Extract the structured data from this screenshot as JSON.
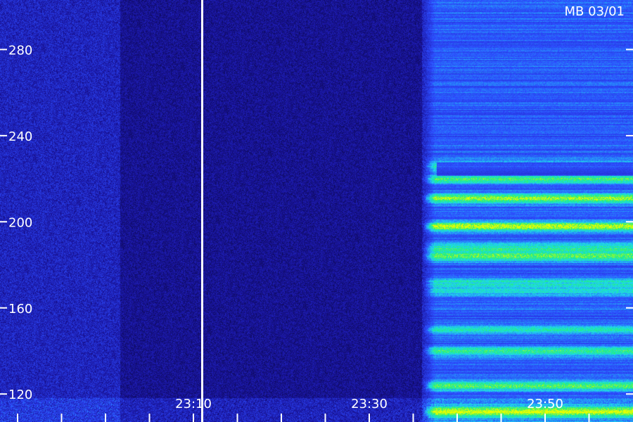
{
  "station_label": "MB 03/01",
  "chart_data": {
    "type": "heatmap",
    "title": "",
    "xlabel": "",
    "ylabel": "",
    "x_tick_labels": [
      "23:10",
      "23:30",
      "23:50"
    ],
    "x_minor_ticks_minutes": [
      -10,
      -5,
      0,
      5,
      10,
      15,
      20,
      25,
      30,
      35,
      40,
      45,
      50,
      55
    ],
    "y_tick_labels": [
      "280",
      "240",
      "200",
      "160",
      "120"
    ],
    "y_ticks": [
      280,
      240,
      200,
      160,
      120
    ],
    "ylim": [
      107,
      303
    ],
    "xlim_minutes_after_2300": [
      -12,
      60
    ],
    "colormap": [
      "#000010",
      "#1a14a0",
      "#2d4cff",
      "#1fd8f0",
      "#21f07a",
      "#e8ff00"
    ],
    "divider_line_time": "23:11",
    "burst_onset_time": "23:36",
    "emission_bands": [
      {
        "freq": 211,
        "intensity": 0.9
      },
      {
        "freq": 198,
        "intensity": 0.95
      },
      {
        "freq": 184,
        "intensity": 0.8
      },
      {
        "freq": 220,
        "intensity": 0.65
      },
      {
        "freq": 226,
        "intensity": 0.5
      },
      {
        "freq": 188,
        "intensity": 0.55
      },
      {
        "freq": 172,
        "intensity": 0.45
      },
      {
        "freq": 168,
        "intensity": 0.4
      },
      {
        "freq": 150,
        "intensity": 0.45
      },
      {
        "freq": 140,
        "intensity": 0.65
      },
      {
        "freq": 124,
        "intensity": 0.7
      },
      {
        "freq": 112,
        "intensity": 0.95
      }
    ]
  },
  "colors": {
    "axis": "#ffffff",
    "background": "#000000"
  }
}
